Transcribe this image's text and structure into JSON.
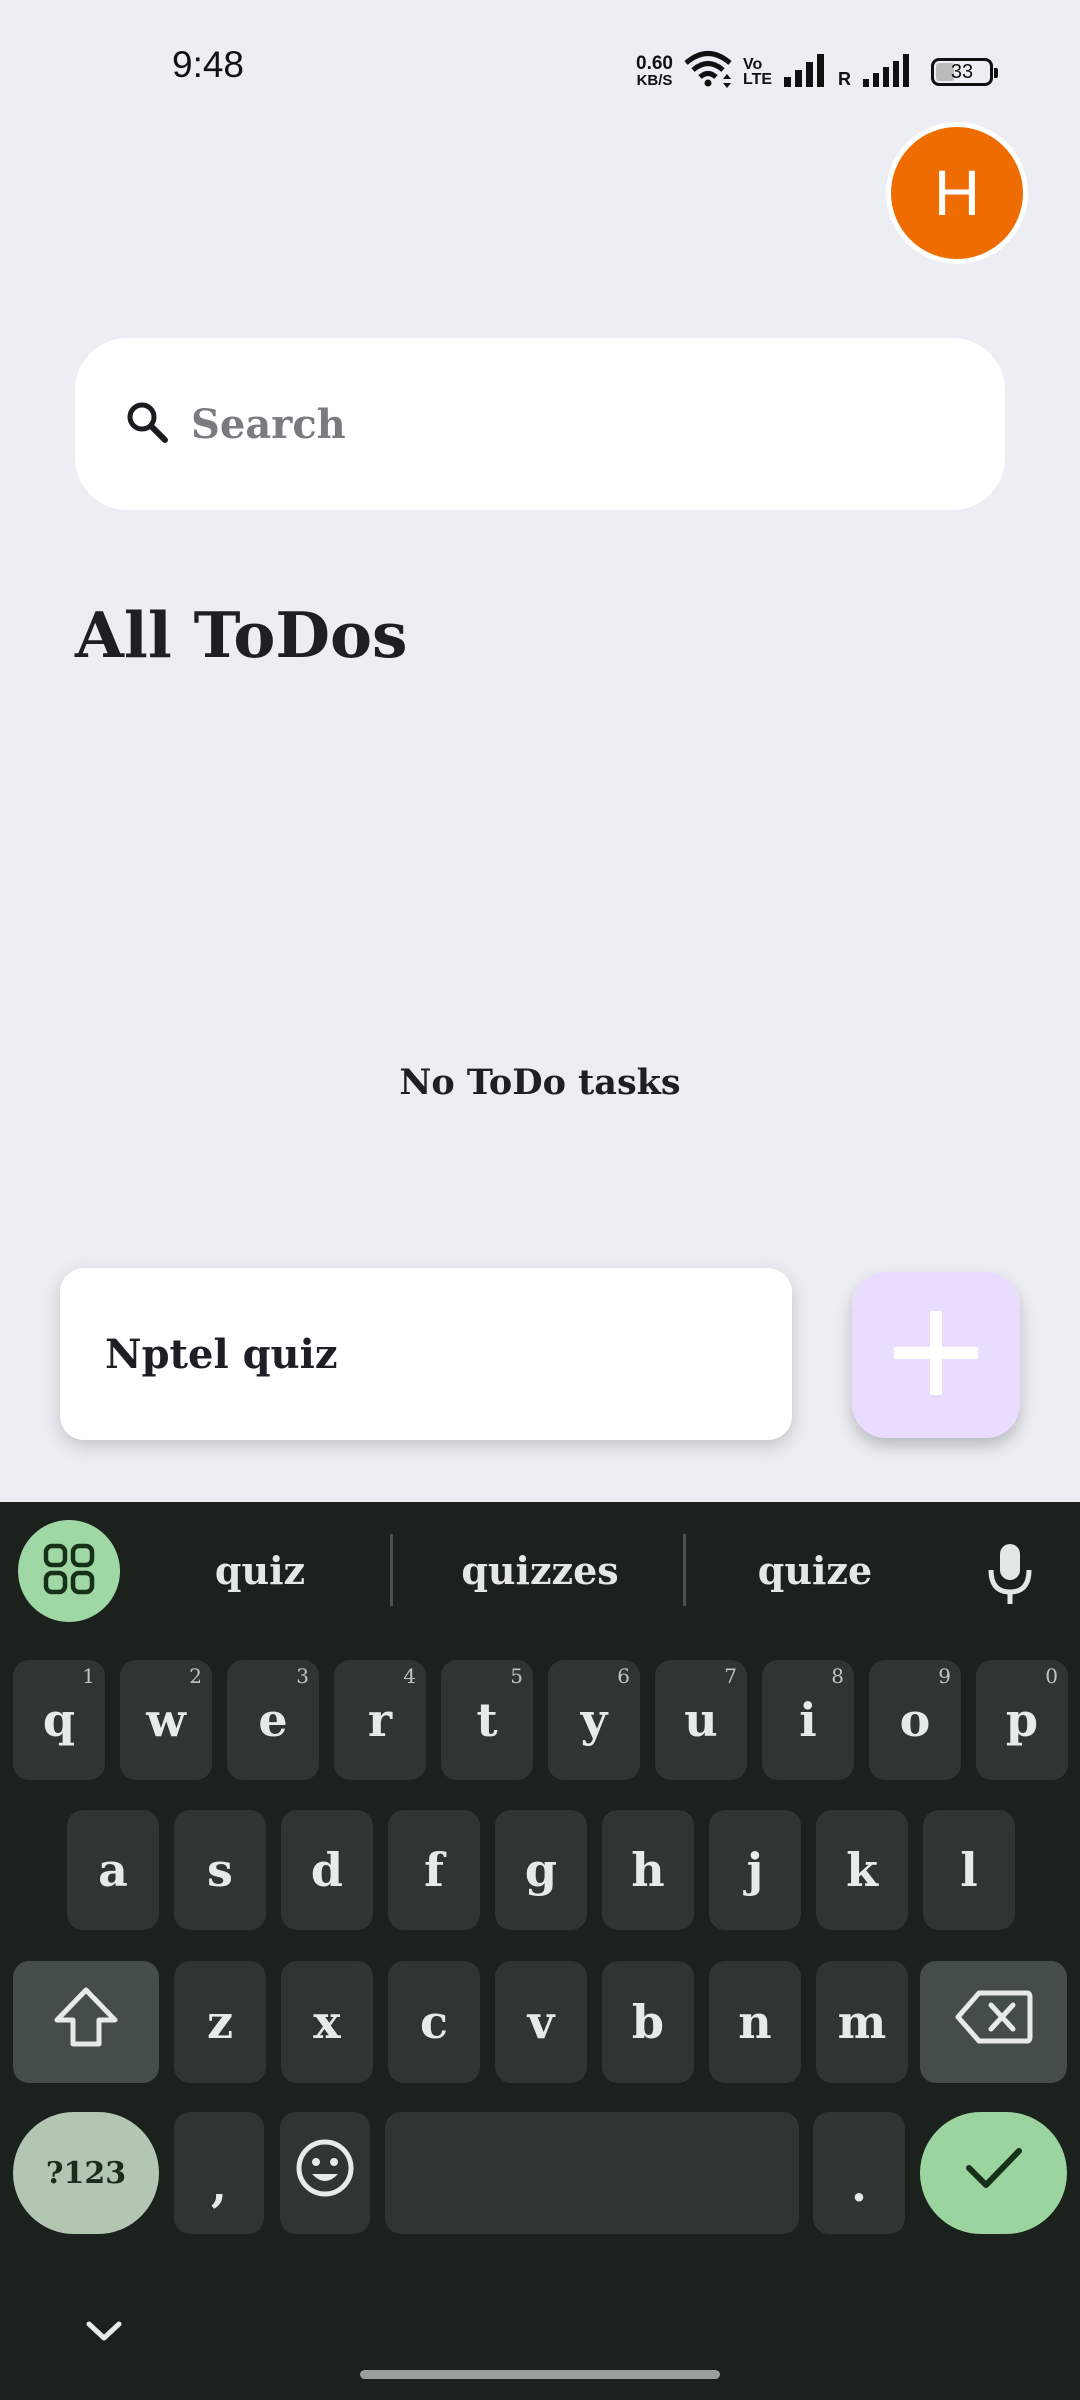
{
  "status_bar": {
    "time": "9:48",
    "net_speed_value": "0.60",
    "net_speed_unit": "KB/S",
    "volte_top": "Vo",
    "volte_bottom": "LTE",
    "roaming": "R",
    "battery": "33"
  },
  "header": {
    "avatar_letter": "H"
  },
  "search": {
    "placeholder": "Search"
  },
  "main": {
    "title": "All ToDos",
    "empty_message": "No ToDo tasks"
  },
  "new_task": {
    "value": "Nptel quiz"
  },
  "colors": {
    "background": "#eceef4",
    "avatar": "#ef6c00",
    "fab": "#eadcff",
    "keyboard": "#1b211d",
    "keyboard_accent": "#9bd49f"
  },
  "keyboard": {
    "suggestions": [
      "quiz",
      "quizzes",
      "quize"
    ],
    "row1": [
      {
        "key": "q",
        "hint": "1"
      },
      {
        "key": "w",
        "hint": "2"
      },
      {
        "key": "e",
        "hint": "3"
      },
      {
        "key": "r",
        "hint": "4"
      },
      {
        "key": "t",
        "hint": "5"
      },
      {
        "key": "y",
        "hint": "6"
      },
      {
        "key": "u",
        "hint": "7"
      },
      {
        "key": "i",
        "hint": "8"
      },
      {
        "key": "o",
        "hint": "9"
      },
      {
        "key": "p",
        "hint": "0"
      }
    ],
    "row2": [
      "a",
      "s",
      "d",
      "f",
      "g",
      "h",
      "j",
      "k",
      "l"
    ],
    "row3": [
      "z",
      "x",
      "c",
      "v",
      "b",
      "n",
      "m"
    ],
    "symbols_label": "?123",
    "comma": ",",
    "period": "."
  }
}
